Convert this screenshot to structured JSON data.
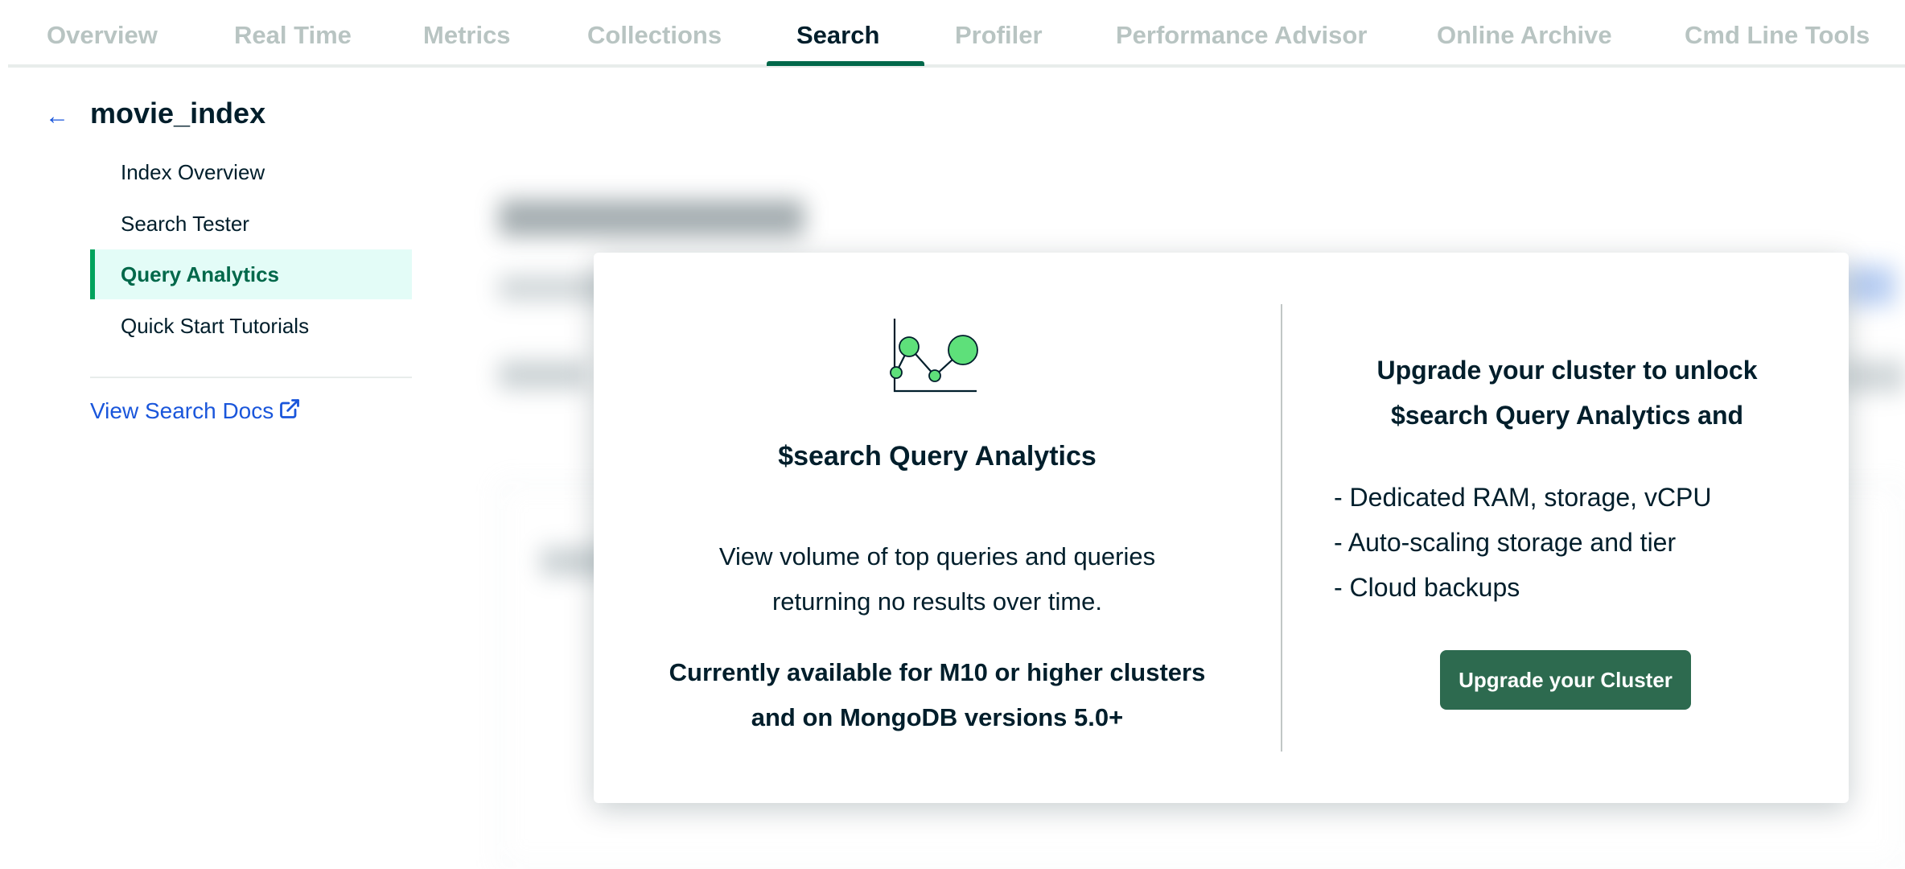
{
  "tabs": [
    {
      "label": "Overview",
      "active": false
    },
    {
      "label": "Real Time",
      "active": false
    },
    {
      "label": "Metrics",
      "active": false
    },
    {
      "label": "Collections",
      "active": false
    },
    {
      "label": "Search",
      "active": true
    },
    {
      "label": "Profiler",
      "active": false
    },
    {
      "label": "Performance Advisor",
      "active": false
    },
    {
      "label": "Online Archive",
      "active": false
    },
    {
      "label": "Cmd Line Tools",
      "active": false
    }
  ],
  "sidebar": {
    "back_icon": "arrow-left-icon",
    "index_name": "movie_index",
    "items": [
      {
        "label": "Index Overview",
        "active": false
      },
      {
        "label": "Search Tester",
        "active": false
      },
      {
        "label": "Query Analytics",
        "active": true
      },
      {
        "label": "Quick Start Tutorials",
        "active": false
      }
    ],
    "docs_link": "View Search Docs",
    "docs_link_icon": "external-link-icon"
  },
  "modal": {
    "icon": "chart-line-icon",
    "feature_title": "$search Query Analytics",
    "feature_desc_lines": [
      "View volume of top queries and queries",
      "returning no results over time."
    ],
    "availability_lines": [
      "Currently available for M10 or higher clusters",
      "and on MongoDB versions 5.0+"
    ],
    "upgrade_heading_lines": [
      "Upgrade your cluster to unlock",
      "$search Query Analytics and"
    ],
    "benefits": [
      "- Dedicated RAM, storage, vCPU",
      "- Auto-scaling storage and tier",
      "- Cloud backups"
    ],
    "upgrade_button": "Upgrade your Cluster"
  },
  "colors": {
    "accent_green": "#00684a",
    "button_green": "#2d6a4f",
    "link_blue": "#1a56db",
    "active_bg": "#e3fcf7",
    "icon_fill": "#5ee07a"
  }
}
